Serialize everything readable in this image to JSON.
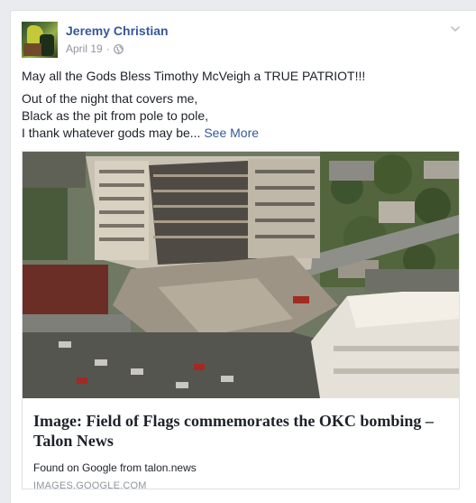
{
  "post": {
    "author": "Jeremy Christian",
    "date": "April 19",
    "separator": "·",
    "privacy_icon": "globe-icon",
    "menu_icon": "chevron-down-icon",
    "text_line1": "May all the Gods Bless Timothy McVeigh a TRUE PATRIOT!!!",
    "text_line2": "Out of the night that covers me,",
    "text_line3": "Black as the pit from pole to pole,",
    "text_line4": "I thank whatever gods may be...",
    "see_more": "See More"
  },
  "link_preview": {
    "title": "Image: Field of Flags commemorates the OKC bombing – Talon News",
    "description": "Found on Google from talon.news",
    "domain": "IMAGES.GOOGLE.COM"
  },
  "colors": {
    "link_blue": "#365899",
    "meta_gray": "#90949c",
    "text": "#1d2129",
    "border": "#dddfe2",
    "background": "#e9ebee"
  }
}
